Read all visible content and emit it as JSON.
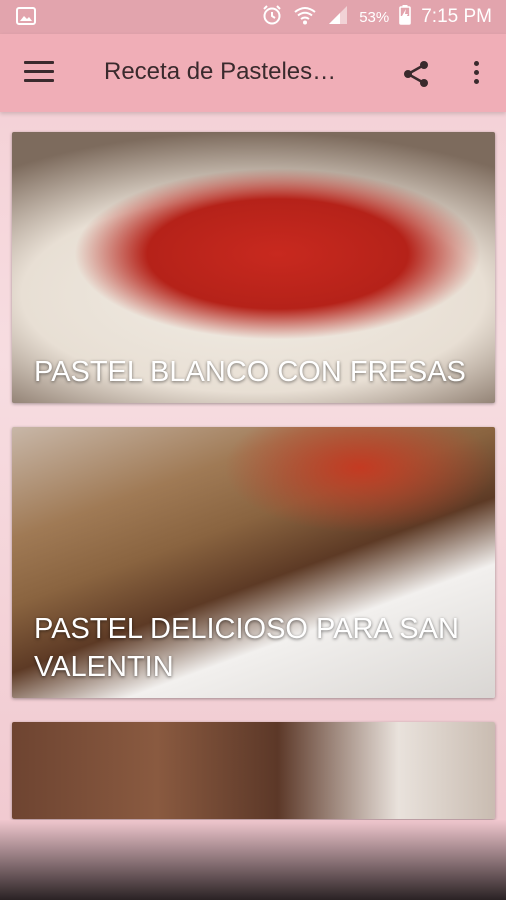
{
  "status_bar": {
    "battery": "53%",
    "time": "7:15 PM",
    "icons": [
      "image-icon",
      "alarm-icon",
      "wifi-icon",
      "signal-icon",
      "battery-charging-icon"
    ]
  },
  "app_bar": {
    "title": "Receta de Pasteles…",
    "icons": [
      "menu-icon",
      "share-icon",
      "more-vert-icon"
    ]
  },
  "cards": [
    {
      "caption": "PASTEL BLANCO CON FRESAS"
    },
    {
      "caption": "PASTEL DELICIOSO PARA SAN VALENTIN"
    },
    {
      "caption": ""
    }
  ],
  "colors": {
    "status_bar": "#e2a4ad",
    "app_bar": "#f0aeb7",
    "background": "#f7dde1"
  }
}
